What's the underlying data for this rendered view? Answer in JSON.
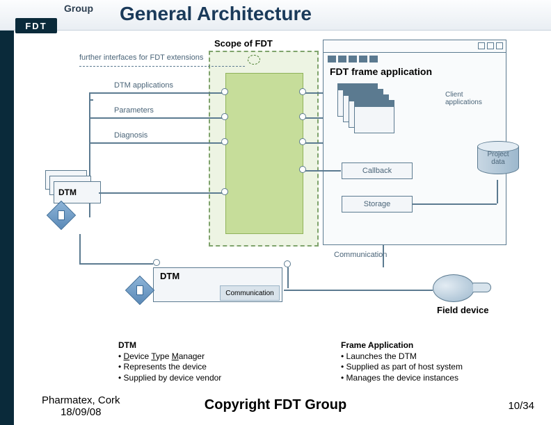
{
  "header": {
    "group": "Group",
    "logo": "FDT",
    "title": "General Architecture"
  },
  "diagram": {
    "scope_label": "Scope of FDT",
    "further_ifaces": "further interfaces for FDT extensions",
    "interfaces": [
      "DTM applications",
      "Parameters",
      "Diagnosis"
    ],
    "dtm": "DTM",
    "comm_dtm": "DTM",
    "comm_sub": "Communication",
    "frame_app": "FDT frame application",
    "client_apps": "Client\napplications",
    "callback": "Callback",
    "storage": "Storage",
    "project_data": "Project\ndata",
    "communication_label": "Communication",
    "field_device": "Field device"
  },
  "descriptions": {
    "dtm": {
      "title": "DTM",
      "l1_pre": "• ",
      "l1_d": "D",
      "l1_mid": "evice ",
      "l1_t": "T",
      "l1_mid2": "ype ",
      "l1_m": "M",
      "l1_end": "anager",
      "l2": "• Represents the device",
      "l3": "• Supplied by device vendor"
    },
    "frame": {
      "title": "Frame Application",
      "l1": "• Launches the DTM",
      "l2": "• Supplied as part of host system",
      "l3": "• Manages the device instances"
    }
  },
  "footer": {
    "location": "Pharmatex, Cork",
    "date": "18/09/08",
    "copyright": "Copyright FDT Group",
    "page": "10/34"
  }
}
